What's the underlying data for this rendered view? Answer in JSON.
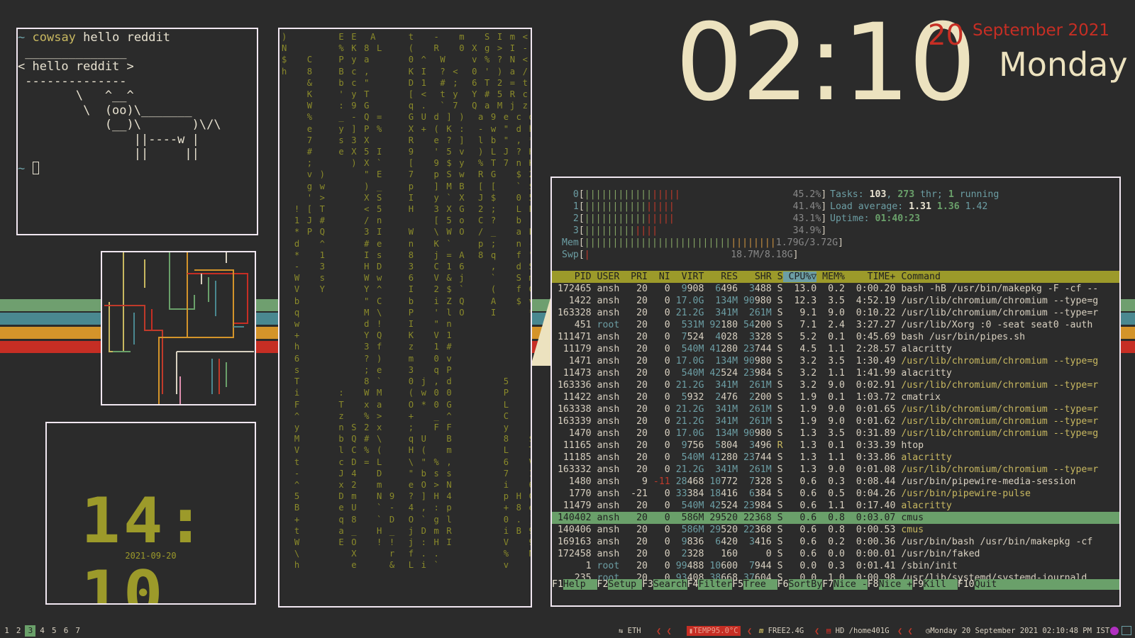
{
  "cowsay": {
    "prompt": "~",
    "command": "cowsay",
    "args": "hello reddit",
    "art": " ______________\n< hello reddit >\n --------------\n        \\   ^__^\n         \\  (oo)\\_______\n            (__)\\       )\\/\\\n                ||----w |\n                ||     ||",
    "prompt2": "~"
  },
  "small_clock": {
    "time": "14: 10",
    "date": "2021-09-20"
  },
  "matrix": {
    "lines": [
      ")        E E  A     t   -   m   S I m <",
      "N        % K 8 L    (   R   0 X g > I -",
      "$   C    P y a      0 ^  W    v % ? N <",
      "h   8    B c ,      K I  ? <  0 ' ) a /",
      "    &    b c \"      D 1  # ;  6 T 2 = t",
      "    K    ' y T      [ <  t y  Y # 5 R c",
      "    W    : 9 G      q .  ` 7  Q a M j z",
      "    %    _ - Q =    G U d ] )  a 9 e c d",
      "    e    y ] P %    X + ( K :  - w \" d h",
      "    7    s 3 X      R   e ? ]  l b \" , *",
      "    #    e X 5 I    9   ' 5 v  ) L J ? H",
      "    ;      ) X `    [   9 $ y  % T 7 n K",
      "    v )      \" E    7   p S w  R G   $ 2",
      "    g w      ) _    p   ] M B  [ [   ` $",
      "    ' >      X S    I   y ` X  J $   0 5",
      "  ! [ T      < 5    H   3 X G  2 ;   L P",
      "  1 J #      / n        [ 5 o  C ?   b (",
      "  * P Q      3 I    W   \\ W O  / _   a L",
      "  d   ^      # e    n   K `    p ;   n -",
      "  *   1      I s    8   j = A  8 q   f \"",
      "  -   3      H D    3   C 1 6    ,   d S",
      "  W   s      W w    6   V & j    `   S m",
      "  V   Y      Y ^    I   2 $ `    (   f C",
      "  b          \" C    b   i Z Q    A   $ v",
      "  q          M \\    P   ' l O    I     *",
      "  w          d !    I   \" n",
      "  +          Y Q    K   V 1",
      "  h          3 f    z   1 #",
      "  6          ? )    m   0 v",
      "  s          ; e    3   q P",
      "  T          8 `    0 j , d        5",
      "  i      :   W M    ( w 0 0        P",
      "  F      T   x a    O * 0 G        L",
      "  ^      z   % >    +   _ ^        C",
      "  y      n S 2 x    ;   F F        y",
      "  M      b Q # \\    q U   B        8   $",
      "  V      l C % (    H (   m        L   T",
      "  t      c D = L    \\ \" % ,        6   V",
      "  -      J 4   D    \" b s s        7   1",
      "  ^      x 2   m    e O > N        i   6",
      "  5      D m   N 9  ? ] H 4        p H C",
      "  B      e U   ` -  4 , : p        + 8 e",
      "  +      q 8   ` D  O ` g l        0 . )",
      "  t      a _   H _  j D m R        i B 9",
      "  W      E O   ! !  j : H I        V   9",
      "  \\        X     r  f . .          %   N",
      "  h        e     &  L i `          v   ("
    ]
  },
  "desktop_clock": {
    "time": "02:10",
    "day": "20",
    "month_year": "September 2021",
    "weekday": "Monday"
  },
  "htop": {
    "cpus": [
      {
        "label": "0",
        "percent": "45.2%"
      },
      {
        "label": "1",
        "percent": "41.4%"
      },
      {
        "label": "2",
        "percent": "43.1%"
      },
      {
        "label": "3",
        "percent": "34.9%"
      }
    ],
    "mem": {
      "label": "Mem",
      "value": "1.79G/3.72G"
    },
    "swp": {
      "label": "Swp",
      "value": "18.7M/8.18G"
    },
    "tasks_label": "Tasks:",
    "tasks": "103",
    "thr": "273",
    "thr_label": "thr;",
    "running": "1",
    "running_label": "running",
    "load_label": "Load average:",
    "load1": "1.31",
    "load5": "1.36",
    "load15": "1.42",
    "uptime_label": "Uptime:",
    "uptime": "01:40:23",
    "headers": [
      "PID",
      "USER",
      "PRI",
      "NI",
      "VIRT",
      "RES",
      "SHR",
      "S",
      "CPU%▽",
      "MEM%",
      "TIME+",
      "Command"
    ],
    "processes": [
      [
        "172465",
        "ansh",
        "20",
        "0",
        "9908",
        "6496",
        "3488",
        "S",
        "13.0",
        "0.2",
        "0:00.20",
        "bash -hB /usr/bin/makepkg -F -cf --"
      ],
      [
        "1422",
        "ansh",
        "20",
        "0",
        "17.0G",
        "134M",
        "90980",
        "S",
        "12.3",
        "3.5",
        "4:52.19",
        "/usr/lib/chromium/chromium --type=g"
      ],
      [
        "163328",
        "ansh",
        "20",
        "0",
        "21.2G",
        "341M",
        "261M",
        "S",
        "9.1",
        "9.0",
        "0:10.22",
        "/usr/lib/chromium/chromium --type=r"
      ],
      [
        "451",
        "root",
        "20",
        "0",
        "531M",
        "92180",
        "54200",
        "S",
        "7.1",
        "2.4",
        "3:27.27",
        "/usr/lib/Xorg :0 -seat seat0 -auth"
      ],
      [
        "111471",
        "ansh",
        "20",
        "0",
        "7524",
        "4028",
        "3328",
        "S",
        "5.2",
        "0.1",
        "0:45.69",
        "bash /usr/bin/pipes.sh"
      ],
      [
        "11179",
        "ansh",
        "20",
        "0",
        "540M",
        "41280",
        "23744",
        "S",
        "4.5",
        "1.1",
        "2:28.57",
        "alacritty"
      ],
      [
        "1471",
        "ansh",
        "20",
        "0",
        "17.0G",
        "134M",
        "90980",
        "S",
        "3.2",
        "3.5",
        "1:30.49",
        "/usr/lib/chromium/chromium --type=g"
      ],
      [
        "11473",
        "ansh",
        "20",
        "0",
        "540M",
        "42524",
        "23984",
        "S",
        "3.2",
        "1.1",
        "1:41.99",
        "alacritty"
      ],
      [
        "163336",
        "ansh",
        "20",
        "0",
        "21.2G",
        "341M",
        "261M",
        "S",
        "3.2",
        "9.0",
        "0:02.91",
        "/usr/lib/chromium/chromium --type=r"
      ],
      [
        "11422",
        "ansh",
        "20",
        "0",
        "5932",
        "2476",
        "2200",
        "S",
        "1.9",
        "0.1",
        "1:03.72",
        "cmatrix"
      ],
      [
        "163338",
        "ansh",
        "20",
        "0",
        "21.2G",
        "341M",
        "261M",
        "S",
        "1.9",
        "9.0",
        "0:01.65",
        "/usr/lib/chromium/chromium --type=r"
      ],
      [
        "163339",
        "ansh",
        "20",
        "0",
        "21.2G",
        "341M",
        "261M",
        "S",
        "1.9",
        "9.0",
        "0:01.62",
        "/usr/lib/chromium/chromium --type=r"
      ],
      [
        "1470",
        "ansh",
        "20",
        "0",
        "17.0G",
        "134M",
        "90980",
        "S",
        "1.3",
        "3.5",
        "0:31.89",
        "/usr/lib/chromium/chromium --type=g"
      ],
      [
        "11165",
        "ansh",
        "20",
        "0",
        "9756",
        "5804",
        "3496",
        "R",
        "1.3",
        "0.1",
        "0:33.39",
        "htop"
      ],
      [
        "11185",
        "ansh",
        "20",
        "0",
        "540M",
        "41280",
        "23744",
        "S",
        "1.3",
        "1.1",
        "0:33.86",
        "alacritty"
      ],
      [
        "163332",
        "ansh",
        "20",
        "0",
        "21.2G",
        "341M",
        "261M",
        "S",
        "1.3",
        "9.0",
        "0:01.08",
        "/usr/lib/chromium/chromium --type=r"
      ],
      [
        "1480",
        "ansh",
        "9",
        "-11",
        "28468",
        "10772",
        "7328",
        "S",
        "0.6",
        "0.3",
        "0:08.44",
        "/usr/bin/pipewire-media-session"
      ],
      [
        "1770",
        "ansh",
        "-21",
        "0",
        "33384",
        "18416",
        "6384",
        "S",
        "0.6",
        "0.5",
        "0:04.26",
        "/usr/bin/pipewire-pulse"
      ],
      [
        "11479",
        "ansh",
        "20",
        "0",
        "540M",
        "42524",
        "23984",
        "S",
        "0.6",
        "1.1",
        "0:17.40",
        "alacritty"
      ],
      [
        "140402",
        "ansh",
        "20",
        "0",
        "586M",
        "29520",
        "22368",
        "S",
        "0.6",
        "0.8",
        "0:03.07",
        "cmus"
      ],
      [
        "140406",
        "ansh",
        "20",
        "0",
        "586M",
        "29520",
        "22368",
        "S",
        "0.6",
        "0.8",
        "0:00.53",
        "cmus"
      ],
      [
        "169163",
        "ansh",
        "20",
        "0",
        "9836",
        "6420",
        "3416",
        "S",
        "0.6",
        "0.2",
        "0:00.36",
        "/usr/bin/bash /usr/bin/makepkg -cf"
      ],
      [
        "172458",
        "ansh",
        "20",
        "0",
        "2328",
        "160",
        "0",
        "S",
        "0.6",
        "0.0",
        "0:00.01",
        "/usr/bin/faked"
      ],
      [
        "1",
        "root",
        "20",
        "0",
        "99488",
        "10600",
        "7944",
        "S",
        "0.0",
        "0.3",
        "0:01.41",
        "/sbin/init"
      ],
      [
        "235",
        "root",
        "20",
        "0",
        "93408",
        "38668",
        "37604",
        "S",
        "0.0",
        "1.0",
        "0:00.98",
        "/usr/lib/systemd/systemd-journald"
      ]
    ],
    "fkeys": [
      {
        "key": "F1",
        "label": "Help"
      },
      {
        "key": "F2",
        "label": "Setup"
      },
      {
        "key": "F3",
        "label": "Search"
      },
      {
        "key": "F4",
        "label": "Filter"
      },
      {
        "key": "F5",
        "label": "Tree"
      },
      {
        "key": "F6",
        "label": "SortBy"
      },
      {
        "key": "F7",
        "label": "Nice -"
      },
      {
        "key": "F8",
        "label": "Nice +"
      },
      {
        "key": "F9",
        "label": "Kill"
      },
      {
        "key": "F10",
        "label": "Quit"
      }
    ]
  },
  "statusbar": {
    "workspaces": [
      "1",
      "2",
      "3",
      "4",
      "5",
      "6",
      "7"
    ],
    "active_workspace": "3",
    "eth": "ETH",
    "temp": "TEMP95.0°C",
    "free": "FREE2.4G",
    "hd": "HD /home401G",
    "datetime": "Monday 20 September 2021 02:10:48 PM IST"
  },
  "colors": {
    "background": "#2b2b2b",
    "frame": "#f1e7f1",
    "accent_olive": "#9c9a2a",
    "accent_green": "#6aa06a",
    "accent_red": "#c62e24",
    "cream": "#ece2bf",
    "teal": "#6c9ea4"
  }
}
